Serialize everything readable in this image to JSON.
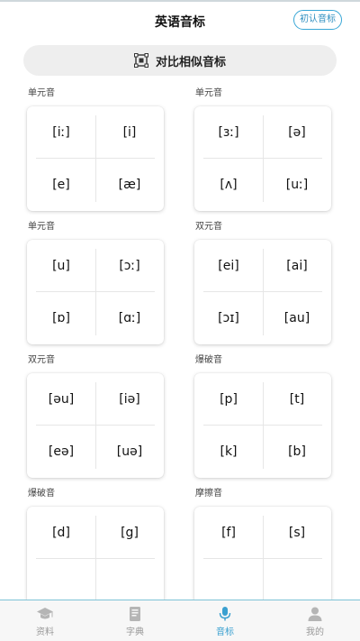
{
  "header": {
    "title": "英语音标",
    "init_button": "初认音标"
  },
  "compare": {
    "label": "对比相似音标",
    "icon": "compare-icon"
  },
  "groups": [
    {
      "title": "单元音",
      "symbols": [
        "[iː]",
        "[i]",
        "[e]",
        "[æ]"
      ]
    },
    {
      "title": "单元音",
      "symbols": [
        "[ɜː]",
        "[ə]",
        "[ʌ]",
        "[uː]"
      ]
    },
    {
      "title": "单元音",
      "symbols": [
        "[u]",
        "[ɔː]",
        "[ɒ]",
        "[ɑː]"
      ]
    },
    {
      "title": "双元音",
      "symbols": [
        "[ei]",
        "[ai]",
        "[ɔɪ]",
        "[au]"
      ]
    },
    {
      "title": "双元音",
      "symbols": [
        "[əu]",
        "[iə]",
        "[eə]",
        "[uə]"
      ]
    },
    {
      "title": "爆破音",
      "symbols": [
        "[p]",
        "[t]",
        "[k]",
        "[b]"
      ]
    },
    {
      "title": "爆破音",
      "symbols": [
        "[d]",
        "[g]",
        "",
        ""
      ]
    },
    {
      "title": "摩擦音",
      "symbols": [
        "[f]",
        "[s]",
        "",
        ""
      ]
    }
  ],
  "tabbar": {
    "items": [
      {
        "label": "资料",
        "icon": "graduation-cap-icon"
      },
      {
        "label": "字典",
        "icon": "book-icon"
      },
      {
        "label": "音标",
        "icon": "microphone-icon"
      },
      {
        "label": "我的",
        "icon": "user-icon"
      }
    ],
    "active_index": 2
  },
  "colors": {
    "accent": "#3aa0d0",
    "inactive": "#999999",
    "card_bg": "#ffffff",
    "pill_bg": "#eeeeee"
  }
}
